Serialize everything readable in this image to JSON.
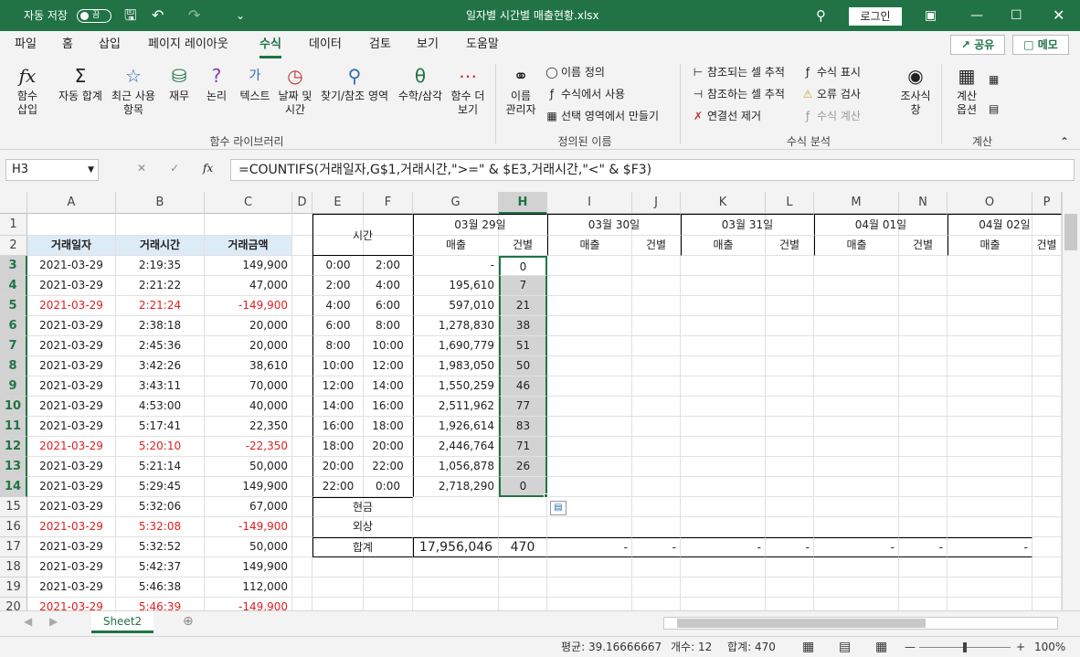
{
  "titlebar": {
    "autosave": "자동 저장",
    "toggle": "끔",
    "filename": "일자별 시간별 매출현황.xlsx",
    "login": "로그인"
  },
  "menu": {
    "tabs": [
      "파일",
      "홈",
      "삽입",
      "페이지 레이아웃",
      "수식",
      "데이터",
      "검토",
      "보기",
      "도움말"
    ],
    "active": "수식",
    "share": "공유",
    "memo": "메모"
  },
  "ribbon": {
    "insert_fn": "함수\n삽입",
    "autosum": "자동 합계",
    "recent": "최근 사용\n항목",
    "finance": "재무",
    "logic": "논리",
    "text": "텍스트",
    "datetime": "날짜 및\n시간",
    "lookup": "찾기/참조 영역",
    "math": "수학/삼각",
    "more": "함수 더\n보기",
    "group_lib": "함수 라이브러리",
    "name_mgr": "이름\n관리자",
    "define_name": "이름 정의",
    "use_formula": "수식에서 사용",
    "create_sel": "선택 영역에서 만들기",
    "group_names": "정의된 이름",
    "trace_prec": "참조되는 셀 추적",
    "trace_dep": "참조하는 셀 추적",
    "remove_arrows": "연결선 제거",
    "show_formulas": "수식 표시",
    "error_check": "오류 검사",
    "eval_formula": "수식 계산",
    "watch": "조사식\n창",
    "group_audit": "수식 분석",
    "calc_options": "계산\n옵션",
    "group_calc": "계산"
  },
  "formula_bar": {
    "cell_ref": "H3",
    "fx": "fx",
    "formula": "=COUNTIFS(거래일자,G$1,거래시간,\">=\" & $E3,거래시간,\"<\" & $F3)"
  },
  "columns": [
    "A",
    "B",
    "C",
    "D",
    "E",
    "F",
    "G",
    "H",
    "I",
    "J",
    "K",
    "L",
    "M",
    "N",
    "O",
    "P"
  ],
  "rows": [
    "1",
    "2",
    "3",
    "4",
    "5",
    "6",
    "7",
    "8",
    "9",
    "10",
    "11",
    "12",
    "13",
    "14",
    "15",
    "16",
    "17",
    "18",
    "19",
    "20"
  ],
  "table_headers": {
    "date": "거래일자",
    "time": "거래시간",
    "amount": "거래금액"
  },
  "transactions": [
    {
      "date": "2021-03-29",
      "time": "2:19:35",
      "amount": "149,900",
      "neg": false
    },
    {
      "date": "2021-03-29",
      "time": "2:21:22",
      "amount": "47,000",
      "neg": false
    },
    {
      "date": "2021-03-29",
      "time": "2:21:24",
      "amount": "-149,900",
      "neg": true
    },
    {
      "date": "2021-03-29",
      "time": "2:38:18",
      "amount": "20,000",
      "neg": false
    },
    {
      "date": "2021-03-29",
      "time": "2:45:36",
      "amount": "20,000",
      "neg": false
    },
    {
      "date": "2021-03-29",
      "time": "3:42:26",
      "amount": "38,610",
      "neg": false
    },
    {
      "date": "2021-03-29",
      "time": "3:43:11",
      "amount": "70,000",
      "neg": false
    },
    {
      "date": "2021-03-29",
      "time": "4:53:00",
      "amount": "40,000",
      "neg": false
    },
    {
      "date": "2021-03-29",
      "time": "5:17:41",
      "amount": "22,350",
      "neg": false
    },
    {
      "date": "2021-03-29",
      "time": "5:20:10",
      "amount": "-22,350",
      "neg": true
    },
    {
      "date": "2021-03-29",
      "time": "5:21:14",
      "amount": "50,000",
      "neg": false
    },
    {
      "date": "2021-03-29",
      "time": "5:29:45",
      "amount": "149,900",
      "neg": false
    },
    {
      "date": "2021-03-29",
      "time": "5:32:06",
      "amount": "67,000",
      "neg": false
    },
    {
      "date": "2021-03-29",
      "time": "5:32:08",
      "amount": "-149,900",
      "neg": true
    },
    {
      "date": "2021-03-29",
      "time": "5:32:52",
      "amount": "50,000",
      "neg": false
    },
    {
      "date": "2021-03-29",
      "time": "5:42:37",
      "amount": "149,900",
      "neg": false
    },
    {
      "date": "2021-03-29",
      "time": "5:46:38",
      "amount": "112,000",
      "neg": false
    },
    {
      "date": "2021-03-29",
      "time": "5:46:39",
      "amount": "-149,900",
      "neg": true
    }
  ],
  "summary": {
    "time_label": "시간",
    "sales": "매출",
    "count": "건별",
    "dates": [
      "03월 29일",
      "03월 30일",
      "03월 31일",
      "04월 01일",
      "04월 02일"
    ],
    "slots": [
      {
        "from": "0:00",
        "to": "2:00",
        "sales": "-",
        "cnt": "0"
      },
      {
        "from": "2:00",
        "to": "4:00",
        "sales": "195,610",
        "cnt": "7"
      },
      {
        "from": "4:00",
        "to": "6:00",
        "sales": "597,010",
        "cnt": "21"
      },
      {
        "from": "6:00",
        "to": "8:00",
        "sales": "1,278,830",
        "cnt": "38"
      },
      {
        "from": "8:00",
        "to": "10:00",
        "sales": "1,690,779",
        "cnt": "51"
      },
      {
        "from": "10:00",
        "to": "12:00",
        "sales": "1,983,050",
        "cnt": "50"
      },
      {
        "from": "12:00",
        "to": "14:00",
        "sales": "1,550,259",
        "cnt": "46"
      },
      {
        "from": "14:00",
        "to": "16:00",
        "sales": "2,511,962",
        "cnt": "77"
      },
      {
        "from": "16:00",
        "to": "18:00",
        "sales": "1,926,614",
        "cnt": "83"
      },
      {
        "from": "18:00",
        "to": "20:00",
        "sales": "2,446,764",
        "cnt": "71"
      },
      {
        "from": "20:00",
        "to": "22:00",
        "sales": "1,056,878",
        "cnt": "26"
      },
      {
        "from": "22:00",
        "to": "0:00",
        "sales": "2,718,290",
        "cnt": "0"
      }
    ],
    "cash": "현금",
    "credit": "외상",
    "total": "합계",
    "total_sales": "17,956,046",
    "total_cnt": "470",
    "dash": "-"
  },
  "sheet_tab": "Sheet2",
  "status": {
    "average": "평균: 39.16666667",
    "count": "개수: 12",
    "sum": "합계: 470",
    "zoom": "100%"
  }
}
